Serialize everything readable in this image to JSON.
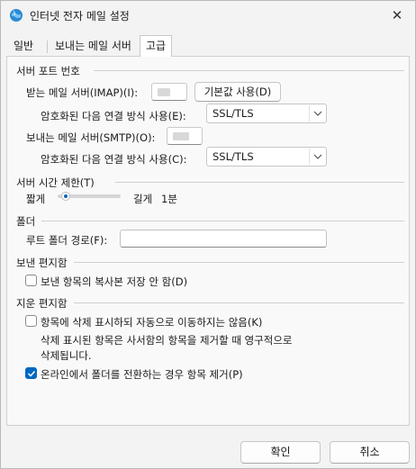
{
  "window": {
    "title": "인터넷 전자 메일 설정",
    "close_glyph": "✕"
  },
  "tabs": [
    {
      "label": "일반",
      "active": false
    },
    {
      "label": "보내는 메일 서버",
      "active": false
    },
    {
      "label": "고급",
      "active": true
    }
  ],
  "server_ports": {
    "heading": "서버 포트 번호",
    "incoming_label": "받는 메일 서버(IMAP)(I):",
    "incoming_value": "",
    "default_button": "기본값 사용(D)",
    "incoming_encryption_label": "암호화된 다음 연결 방식 사용(E):",
    "incoming_encryption_value": "SSL/TLS",
    "outgoing_label": "보내는 메일 서버(SMTP)(O):",
    "outgoing_value": "",
    "outgoing_encryption_label": "암호화된 다음 연결 방식 사용(C):",
    "outgoing_encryption_value": "SSL/TLS"
  },
  "timeout": {
    "heading": "서버 시간 제한(T)",
    "short_label": "짧게",
    "long_label": "길게",
    "value_label": "1분",
    "slider_fraction": 0.07
  },
  "folders": {
    "heading": "폴더",
    "root_label": "루트 폴더 경로(F):",
    "root_value": ""
  },
  "sent_items": {
    "heading": "보낸 편지함",
    "no_copy_label": "보낸 항목의 복사본 저장 안 함(D)",
    "no_copy_checked": false
  },
  "deleted_items": {
    "heading": "지운 편지함",
    "mark_label": "항목에 삭제 표시하되 자동으로 이동하지는 않음(K)",
    "mark_checked": false,
    "note_line1": "삭제 표시된 항목은 사서함의 항목을 제거할 때 영구적으로",
    "note_line2": "삭제됩니다.",
    "purge_label": "온라인에서 폴더를 전환하는 경우 항목 제거(P)",
    "purge_checked": true
  },
  "footer": {
    "ok_label": "확인",
    "cancel_label": "취소"
  },
  "colors": {
    "accent": "#0067c0",
    "window_bg": "#f3f3f3",
    "panel_bg": "#f9f9f9"
  },
  "icons": {
    "app": "outlook-globe-icon",
    "close": "close-icon",
    "dropdown": "chevron-down-icon",
    "check": "checkmark-icon"
  }
}
